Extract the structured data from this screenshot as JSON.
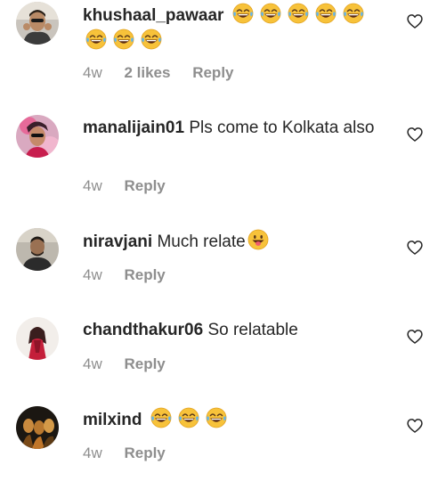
{
  "comments": [
    {
      "username": "khushaal_pawaar",
      "text": "",
      "emoji_name": "laughing-tears-emoji",
      "emoji_count": 8,
      "time": "4w",
      "likes": "2 likes",
      "reply": "Reply"
    },
    {
      "username": "manalijain01",
      "text": "Pls come to Kolkata also",
      "time": "4w",
      "reply": "Reply"
    },
    {
      "username": "niravjani",
      "text": "Much relate",
      "emoji_name": "grinning-tongue-emoji",
      "time": "4w",
      "reply": "Reply"
    },
    {
      "username": "chandthakur06",
      "text": "So relatable",
      "time": "4w",
      "reply": "Reply"
    },
    {
      "username": "milxind",
      "text": "",
      "emoji_name": "laughing-tears-emoji",
      "emoji_count": 3,
      "time": "4w",
      "reply": "Reply"
    }
  ],
  "icons": {
    "like": "heart-outline-icon"
  }
}
